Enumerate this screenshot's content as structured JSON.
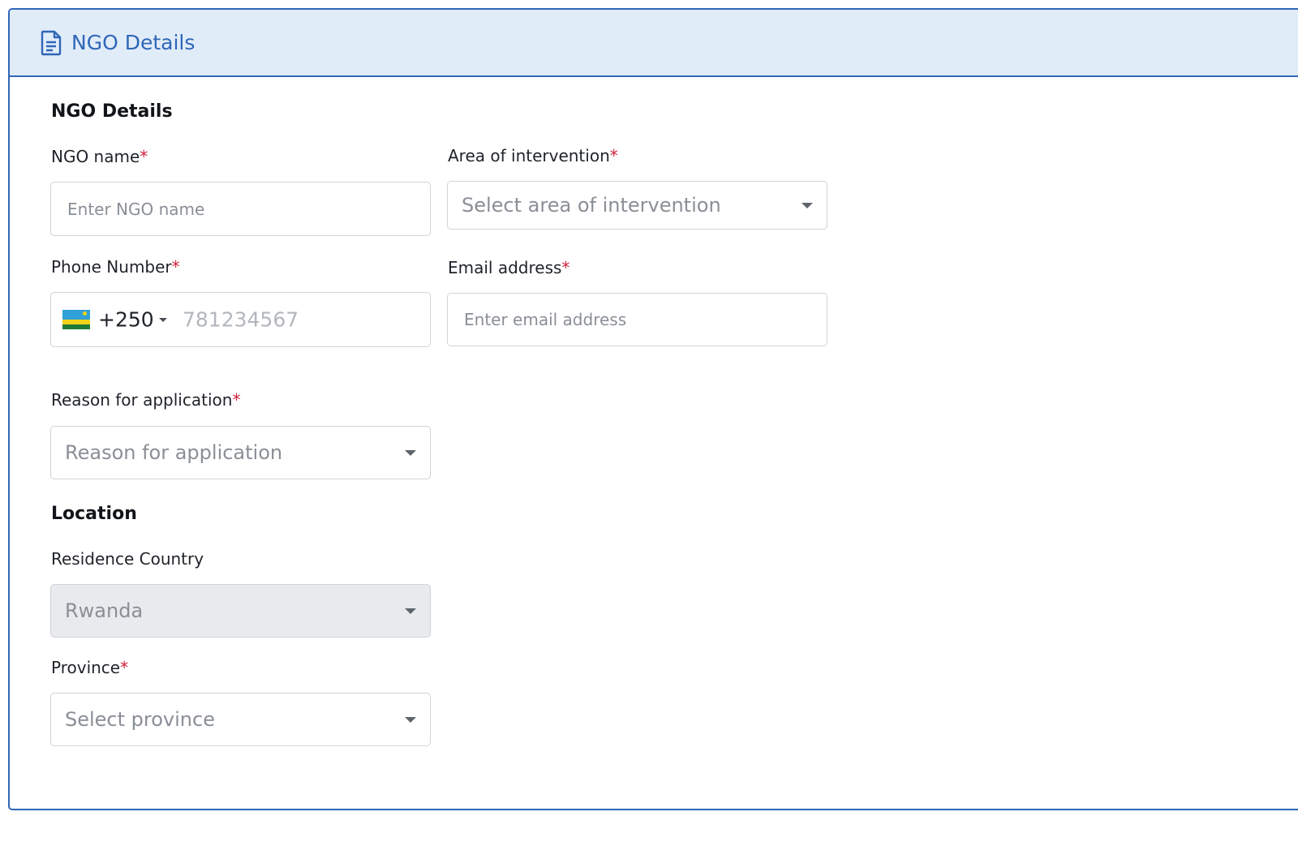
{
  "header": {
    "title": "NGO Details",
    "icon": "document-icon"
  },
  "sections": {
    "details_title": "NGO Details",
    "location_title": "Location"
  },
  "fields": {
    "ngo_name": {
      "label": "NGO name",
      "required_mark": "*",
      "placeholder": "Enter NGO name",
      "value": ""
    },
    "area_of_intervention": {
      "label": "Area of intervention",
      "required_mark": "*",
      "placeholder": "Select area of intervention"
    },
    "phone_number": {
      "label": "Phone Number",
      "required_mark": "*",
      "country_code": "+250",
      "placeholder": "781234567",
      "flag": "rwanda-flag"
    },
    "email_address": {
      "label": "Email address",
      "required_mark": "*",
      "placeholder": "Enter email address",
      "value": ""
    },
    "reason_for_application": {
      "label": "Reason for application",
      "required_mark": "*",
      "placeholder": "Reason for application"
    },
    "residence_country": {
      "label": "Residence Country",
      "value": "Rwanda",
      "disabled": true
    },
    "province": {
      "label": "Province",
      "required_mark": "*",
      "placeholder": "Select province"
    }
  },
  "colors": {
    "accent": "#2f66b8",
    "header_bg": "#e0ecf8",
    "required": "#d0203a",
    "border": "#cfd3d8",
    "placeholder": "#8a8f96",
    "disabled_bg": "#e8eaed"
  }
}
